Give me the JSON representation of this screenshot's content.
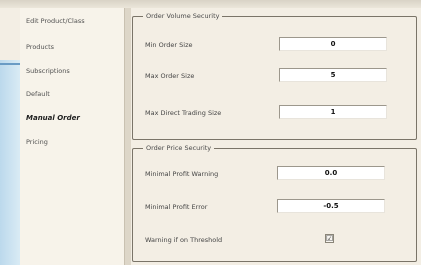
{
  "sidebar": {
    "items": [
      {
        "label": "Edit Product/Class",
        "active": false
      },
      {
        "label": "Products",
        "active": false
      },
      {
        "label": "Subscriptions",
        "active": false
      },
      {
        "label": "Default",
        "active": false
      },
      {
        "label": "Manual Order",
        "active": true
      },
      {
        "label": "Pricing",
        "active": false
      }
    ]
  },
  "order_volume": {
    "title": "Order Volume Security",
    "fields": [
      {
        "label": "Min Order Size",
        "value": "0"
      },
      {
        "label": "Max Order Size",
        "value": "5"
      },
      {
        "label": "Max Direct Trading Size",
        "value": "1"
      }
    ]
  },
  "order_price": {
    "title": "Order Price Security",
    "fields": [
      {
        "label": "Minimal Profit Warning",
        "value": "0.0"
      },
      {
        "label": "Minimal Profit Error",
        "value": "-0.5"
      }
    ],
    "checkbox": {
      "label": "Warning if on Threshold",
      "checked": true,
      "mark": "☑"
    }
  },
  "colors": {
    "background": "#f3eee4",
    "border": "#7a7468",
    "accent": "#6a9bc4"
  }
}
